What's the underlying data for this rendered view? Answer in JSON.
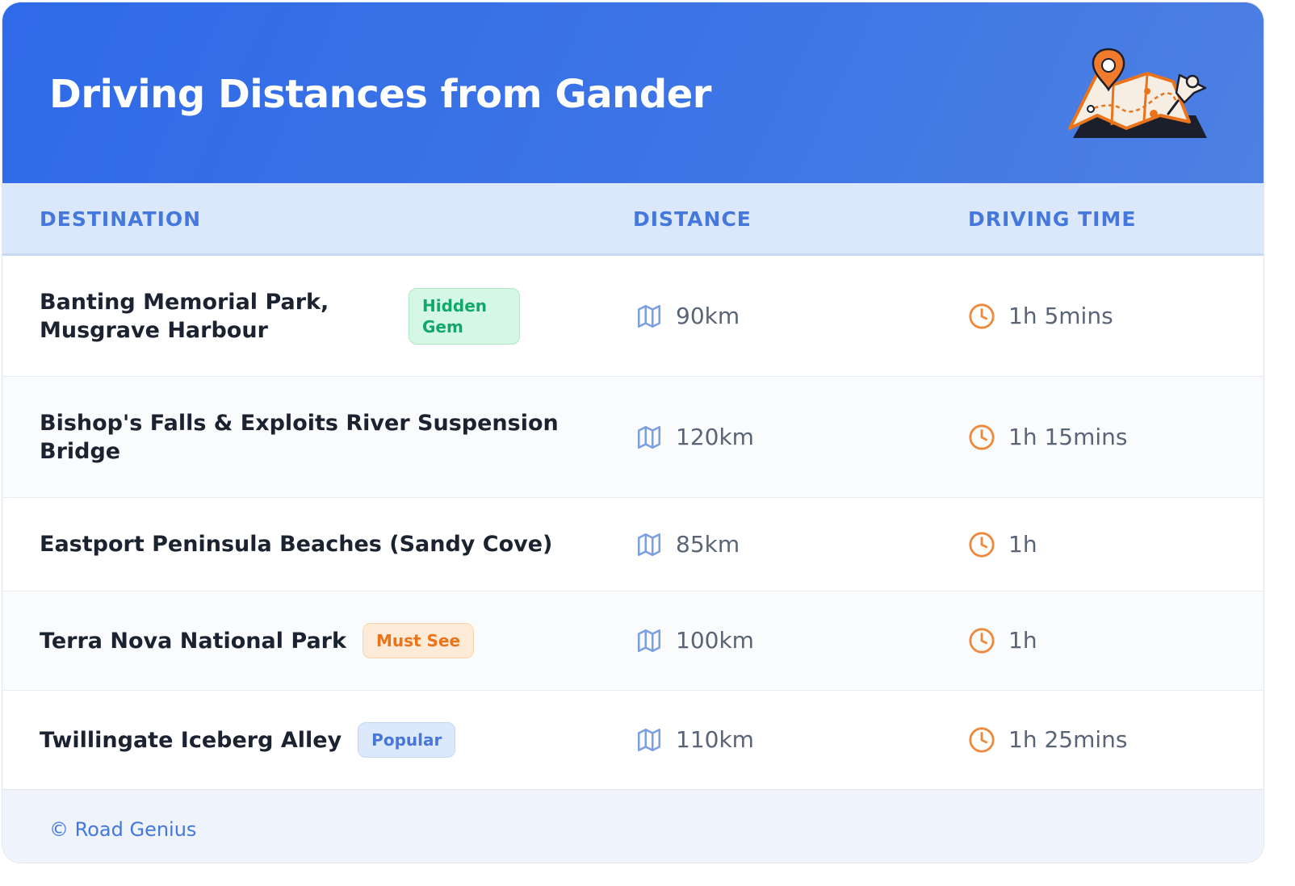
{
  "header": {
    "title": "Driving Distances from Gander",
    "illustration": "folded-map-with-pin-icon"
  },
  "table": {
    "columns": [
      "DESTINATION",
      "DISTANCE",
      "DRIVING TIME"
    ],
    "rows": [
      {
        "destination": "Banting Memorial Park, Musgrave Harbour",
        "destination_line1": "Banting Memorial Park,",
        "destination_line2": "Musgrave Harbour",
        "badge": "Hidden Gem",
        "badge_line1": "Hidden",
        "badge_line2": "Gem",
        "badge_color": "green",
        "distance": "90km",
        "time": "1h 5mins"
      },
      {
        "destination": "Bishop's Falls & Exploits River Suspension Bridge",
        "destination_line1": "Bishop's Falls & Exploits River Suspension",
        "destination_line2": "Bridge",
        "badge": null,
        "distance": "120km",
        "time": "1h 15mins"
      },
      {
        "destination": "Eastport Peninsula Beaches (Sandy Cove)",
        "badge": null,
        "distance": "85km",
        "time": "1h"
      },
      {
        "destination": "Terra Nova National Park",
        "badge": "Must See",
        "badge_color": "orange",
        "distance": "100km",
        "time": "1h"
      },
      {
        "destination": "Twillingate Iceberg Alley",
        "badge": "Popular",
        "badge_color": "blue",
        "distance": "110km",
        "time": "1h 25mins"
      }
    ]
  },
  "icons": {
    "distance": "map-icon",
    "time": "clock-icon"
  },
  "colors": {
    "header_bg": "#3570e6",
    "column_header_text": "#4478dc",
    "map_icon": "#7b9fe3",
    "clock_icon": "#f0883c",
    "badge_green": "#13a86a",
    "badge_orange": "#e9741c",
    "badge_blue": "#4778d8"
  },
  "footer": {
    "text": "© Road Genius"
  }
}
